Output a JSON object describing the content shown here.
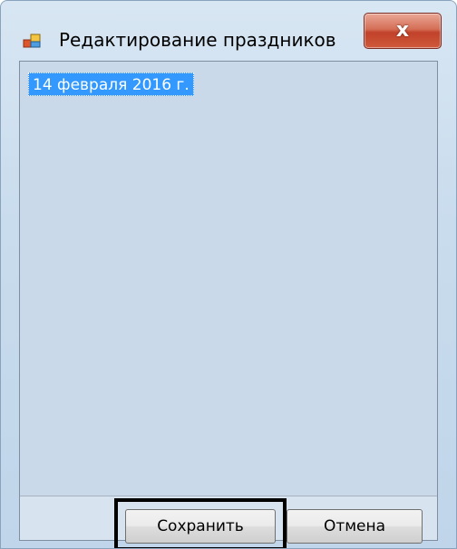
{
  "window": {
    "title": "Редактирование праздников",
    "close_label": "x"
  },
  "icons": {
    "app": "app-window-icon",
    "close": "close-icon"
  },
  "list": {
    "items": [
      {
        "label": "14 февраля 2016 г.",
        "selected": true
      }
    ]
  },
  "buttons": {
    "save_label": "Сохранить",
    "cancel_label": "Отмена"
  },
  "colors": {
    "selection": "#3399ff",
    "close_button": "#c9412a",
    "highlight_frame": "#000000"
  }
}
